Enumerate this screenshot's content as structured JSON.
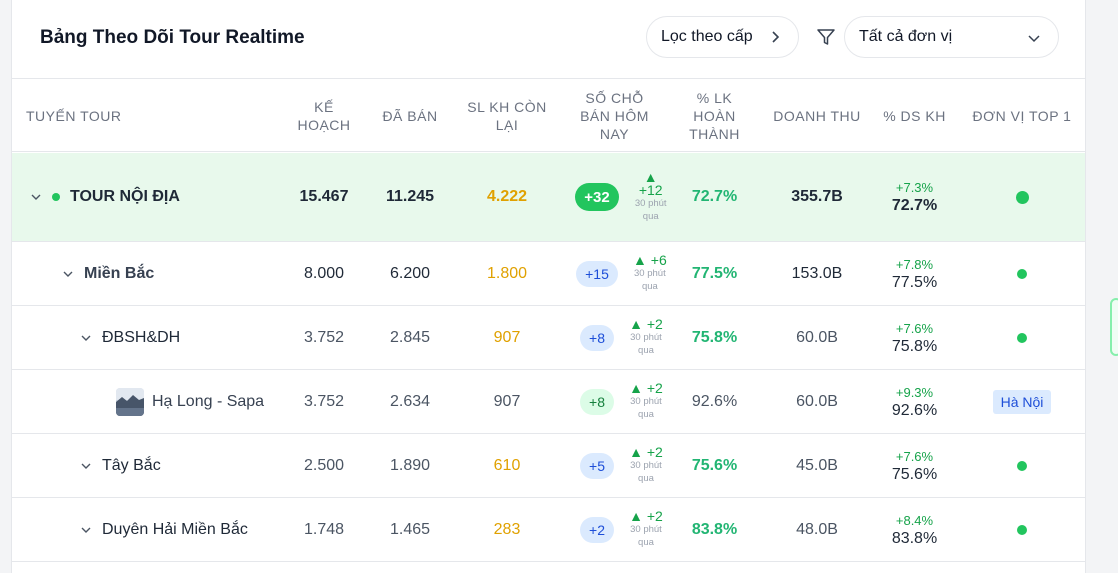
{
  "header": {
    "title": "Bảng Theo Dõi Tour Realtime",
    "filter_button": "Lọc theo cấp",
    "unit_select": "Tất cả đơn vị"
  },
  "columns": [
    "TUYẾN TOUR",
    "KẾ\nHOẠCH",
    "ĐÃ BÁN",
    "SL KH CÒN\nLẠI",
    "SỐ CHỖ\nBÁN HÔM\nNAY",
    "% LK\nHOÀN\nTHÀNH",
    "DOANH THU",
    "% DS KH",
    "ĐƠN VỊ TOP 1"
  ],
  "rows": [
    {
      "name": "TOUR NỘI ĐỊA",
      "plan": "15.467",
      "sold": "11.245",
      "remaining": "4.222",
      "today_badge": "+32",
      "today_delta": "+12",
      "today_note": "30 phút qua",
      "completion": "72.7%",
      "revenue": "355.7B",
      "ds_change": "+7.3%",
      "ds_value": "72.7%"
    },
    {
      "name": "Miền Bắc",
      "plan": "8.000",
      "sold": "6.200",
      "remaining": "1.800",
      "today_badge": "+15",
      "today_delta": "+6",
      "today_note": "30 phút qua",
      "completion": "77.5%",
      "revenue": "153.0B",
      "ds_change": "+7.8%",
      "ds_value": "77.5%"
    },
    {
      "name": "ĐBSH&DH",
      "plan": "3.752",
      "sold": "2.845",
      "remaining": "907",
      "today_badge": "+8",
      "today_delta": "+2",
      "today_note": "30 phút qua",
      "completion": "75.8%",
      "revenue": "60.0B",
      "ds_change": "+7.6%",
      "ds_value": "75.8%"
    },
    {
      "name": "Hạ Long - Sapa",
      "plan": "3.752",
      "sold": "2.634",
      "remaining": "907",
      "today_badge": "+8",
      "today_delta": "+2",
      "today_note": "30 phút qua",
      "completion": "92.6%",
      "revenue": "60.0B",
      "ds_change": "+9.3%",
      "ds_value": "92.6%",
      "top_unit": "Hà Nội"
    },
    {
      "name": "Tây Bắc",
      "plan": "2.500",
      "sold": "1.890",
      "remaining": "610",
      "today_badge": "+5",
      "today_delta": "+2",
      "today_note": "30 phút qua",
      "completion": "75.6%",
      "revenue": "45.0B",
      "ds_change": "+7.6%",
      "ds_value": "75.6%"
    },
    {
      "name": "Duyên Hải Miền Bắc",
      "plan": "1.748",
      "sold": "1.465",
      "remaining": "283",
      "today_badge": "+2",
      "today_delta": "+2",
      "today_note": "30 phút qua",
      "completion": "83.8%",
      "revenue": "48.0B",
      "ds_change": "+8.4%",
      "ds_value": "83.8%"
    }
  ],
  "colors": {
    "accent_green": "#22c55e",
    "amber": "#e0a100",
    "blue_badge": "#dbeafe",
    "top_row_bg": "#e8f9ec"
  }
}
